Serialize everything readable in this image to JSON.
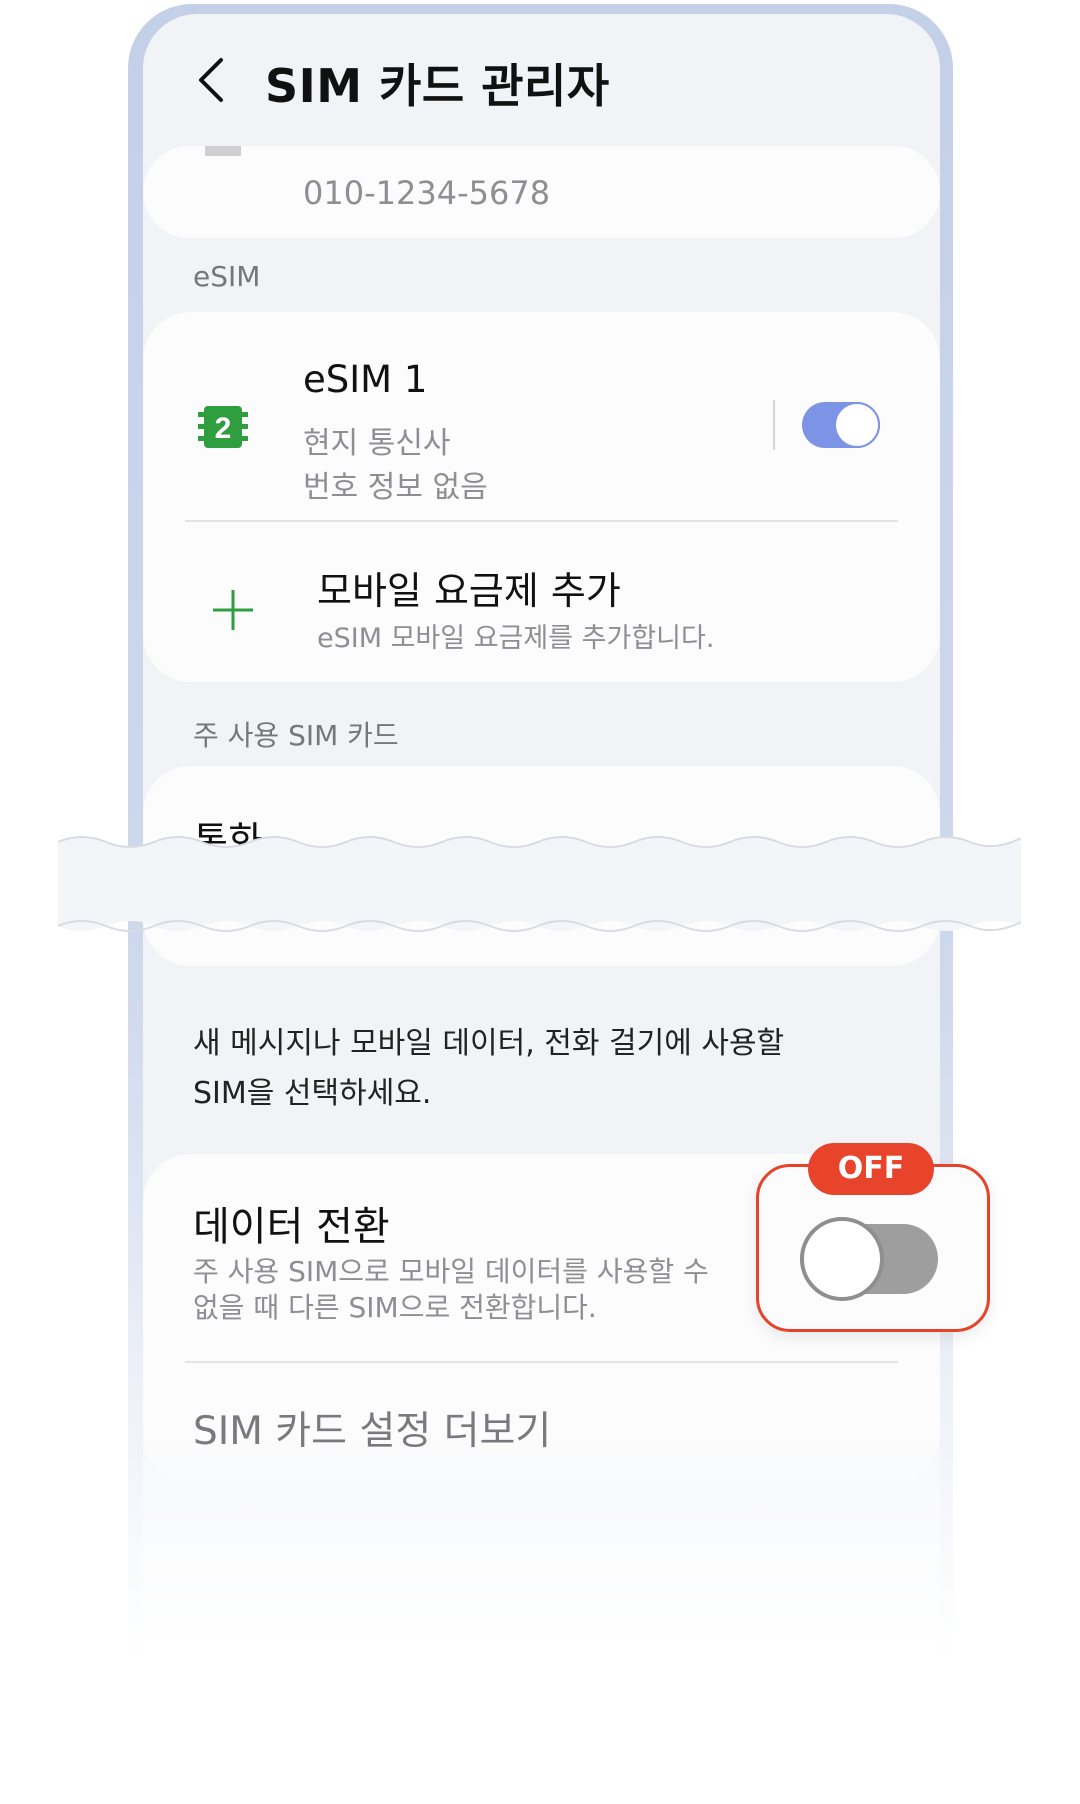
{
  "header": {
    "title": "SIM 카드 관리자",
    "back_icon": "chevron-left-icon"
  },
  "sim_card": {
    "phone_number": "010-1234-5678"
  },
  "esim_section": {
    "label": "eSIM",
    "esim1": {
      "name": "eSIM 1",
      "carrier": "현지 통신사",
      "number_info": "번호 정보 없음",
      "icon_number": "2",
      "icon": "esim-chip-icon",
      "enabled": true
    },
    "add_plan": {
      "title": "모바일 요금제 추가",
      "subtitle": "eSIM 모바일 요금제를 추가합니다.",
      "icon": "plus-icon"
    }
  },
  "primary_sim_section": {
    "label": "주 사용 SIM 카드",
    "call_label": "통화",
    "info": "새 메시지나 모바일 데이터, 전화 걸기에 사용할 SIM을 선택하세요."
  },
  "data_switch": {
    "title": "데이터 전환",
    "description": "주 사용 SIM으로 모바일 데이터를 사용할 수 없을 때 다른 SIM으로 전환합니다.",
    "enabled": false,
    "badge": "OFF"
  },
  "more_settings": {
    "label": "SIM 카드 설정 더보기"
  },
  "colors": {
    "accent_toggle_on": "#7d93e6",
    "toggle_off": "#9e9e9e",
    "highlight": "#e6432a",
    "esim_green": "#2e9e3e"
  }
}
